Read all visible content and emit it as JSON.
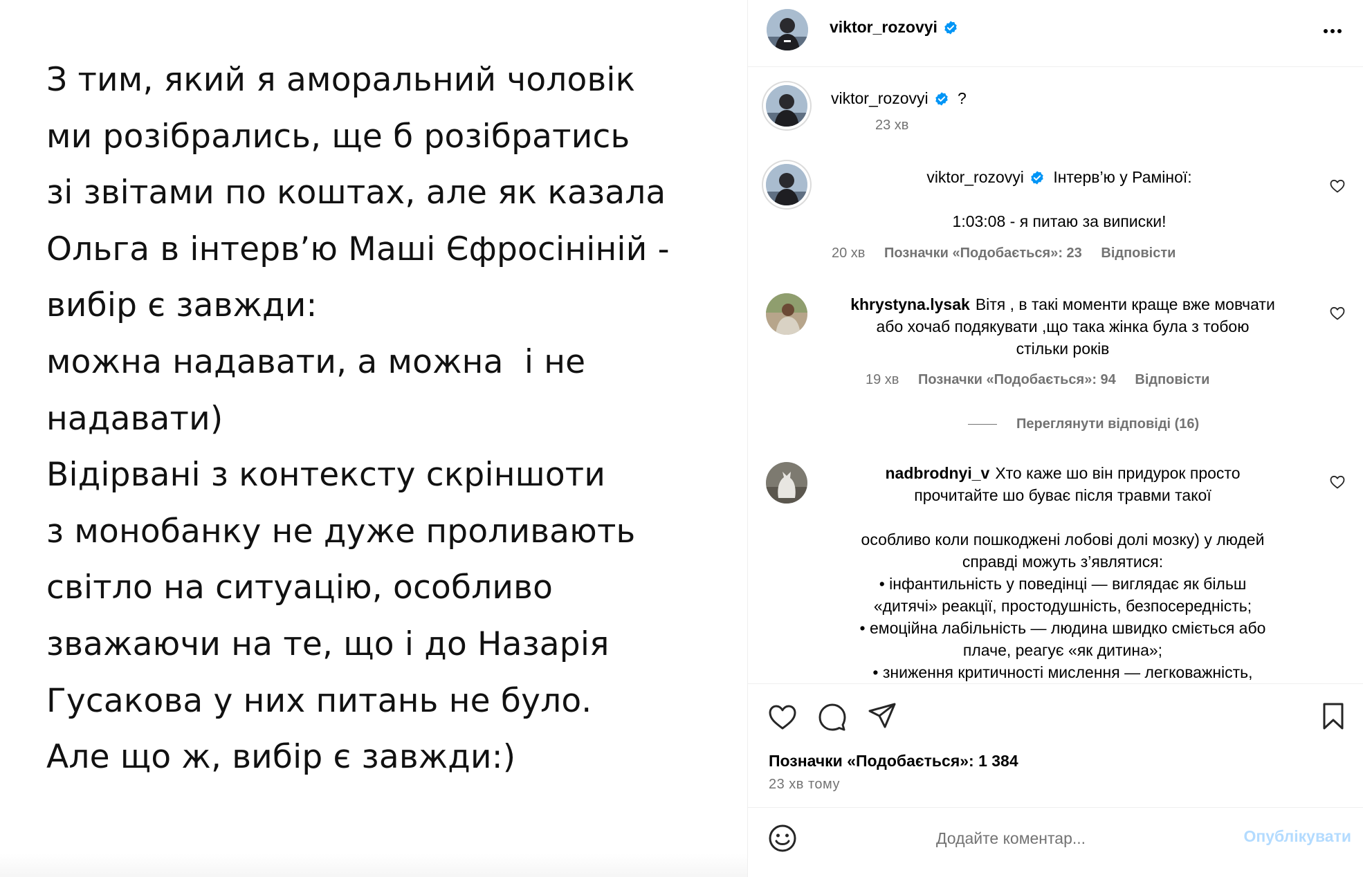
{
  "post": {
    "text_lines": [
      "З тим, який я аморальний чоловік",
      "ми розібрались, ще б розібратись",
      "зі звітами по коштах, але як казала",
      "Ольга в інтерв’ю Маші Єфросініній -",
      "вибір є завжди:",
      "можна надавати, а можна  і не",
      "надавати)",
      "Відірвані з контексту скріншоти",
      "з монобанку не дуже проливають",
      "світло на ситуацію, особливо",
      "зважаючи на те, що і до Назарія",
      "Гусакова у них питань не було.",
      "Але що ж, вибір є завжди:)"
    ]
  },
  "header": {
    "username": "viktor_rozovyi",
    "more_icon": "more-horizontal-icon"
  },
  "comments": [
    {
      "username": "viktor_rozovyi",
      "verified": true,
      "text": "?",
      "time": "23 хв"
    },
    {
      "username": "viktor_rozovyi",
      "verified": true,
      "text": "Інтерв’ю у Раміної:",
      "text2": "1:03:08 - я питаю за випиcки!",
      "time": "20 хв",
      "likes": "Позначки «Подобається»: 23",
      "reply": "Відповісти"
    },
    {
      "username": "khrystyna.lysak",
      "text_lines": [
        "Вітя , в такі моменти краще вже мовчати",
        "або хочаб подякувати ,що така жінка була з тобою",
        "стільки років"
      ],
      "time": "19 хв",
      "likes": "Позначки «Подобається»: 94",
      "reply": "Відповісти",
      "view_replies": "Переглянути відповіді (16)"
    },
    {
      "username": "nadbrodnyi_v",
      "text_lines": [
        "Хто каже шо він придурок просто",
        "прочитайте шо буває після травми такої",
        "",
        "особливо коли пошкоджені лобові долі мозку) у людей",
        "справді можуть з’являтися:",
        "• інфантильність у поведінці — виглядає як більш",
        "«дитячі» реакції, простодушність, безпосередність;",
        "• емоційна лабільність — людина швидко сміється або",
        "плаче, реагує «як дитина»;",
        "• зниження критичності мислення — легковажність,"
      ]
    }
  ],
  "actions": {
    "like_icon": "heart-icon",
    "comment_icon": "comment-icon",
    "share_icon": "share-icon",
    "save_icon": "bookmark-icon",
    "likes": "Позначки «Подобається»: 1 384",
    "posted": "23 хв тому"
  },
  "add_comment": {
    "emoji_icon": "emoji-icon",
    "placeholder": "Додайте коментар...",
    "publish": "Опублікувати"
  },
  "colors": {
    "verified_blue": "#0095f6",
    "secondary_text": "#737373",
    "publish_disabled": "#b3dbff",
    "divider": "#efefef"
  }
}
